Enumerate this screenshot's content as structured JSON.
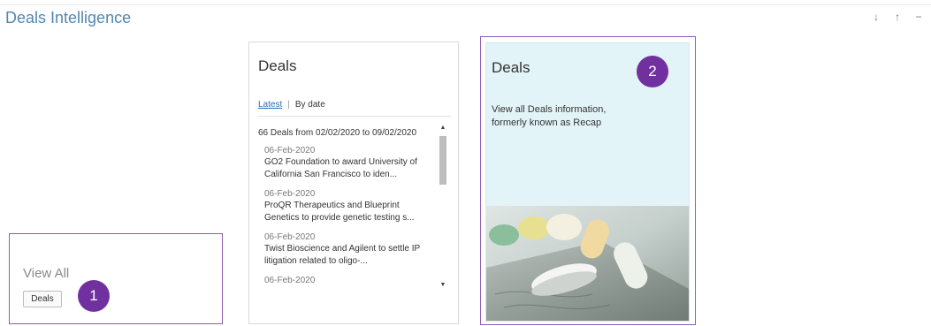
{
  "page": {
    "title": "Deals Intelligence"
  },
  "window_controls": {
    "down": "↓",
    "up": "↑",
    "minimize": "−"
  },
  "left_panel": {
    "view_all_label": "View All",
    "deals_button": "Deals",
    "annotation": "1"
  },
  "deals_card": {
    "title": "Deals",
    "tab_latest": "Latest",
    "tab_separator": "|",
    "tab_by_date": "By date",
    "summary": "66 Deals from 02/02/2020 to 09/02/2020",
    "items": [
      {
        "date": "06-Feb-2020",
        "headline": "GO2 Foundation to award University of California San Francisco to iden..."
      },
      {
        "date": "06-Feb-2020",
        "headline": "ProQR Therapeutics and Blueprint Genetics to provide genetic testing s..."
      },
      {
        "date": "06-Feb-2020",
        "headline": "Twist Bioscience and Agilent to settle IP litigation related to oligo-..."
      },
      {
        "date": "06-Feb-2020",
        "headline": ""
      }
    ]
  },
  "deals_promo_card": {
    "title": "Deals",
    "description": "View all Deals information, formerly known as Recap",
    "annotation": "2",
    "image_icon": "pills-and-money-photo"
  },
  "colors": {
    "accent_title": "#4f88b4",
    "annotation_purple": "#7030a0",
    "annotation_border": "#8e5cb6",
    "promo_bg": "#e3f4f9",
    "link": "#2a6db0"
  }
}
